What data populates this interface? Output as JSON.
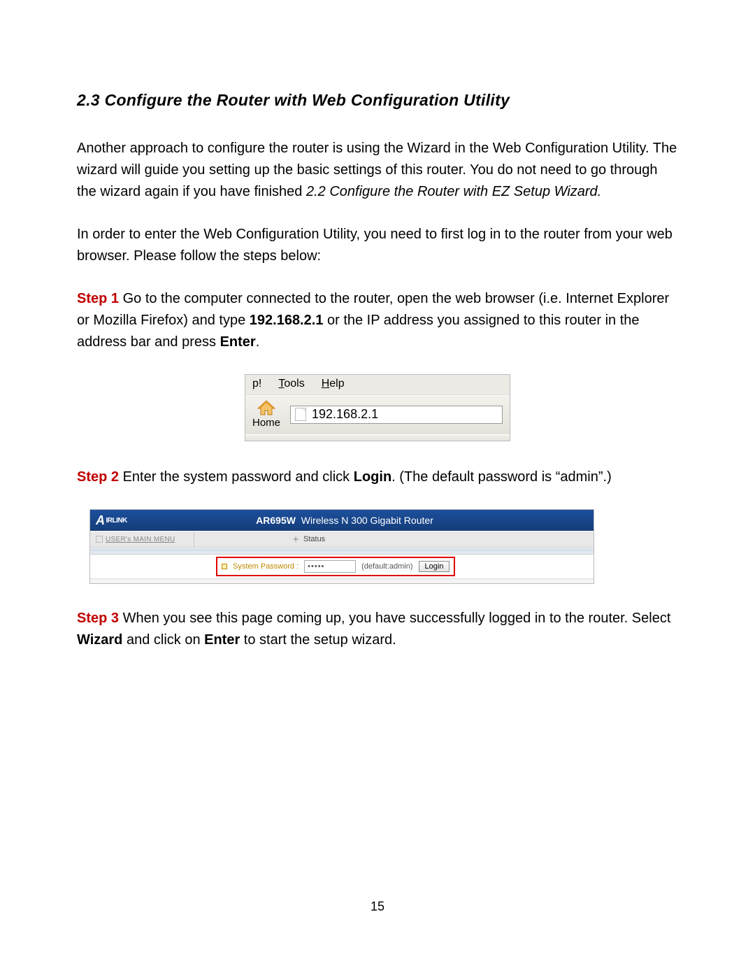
{
  "section": {
    "title": "2.3 Configure the Router with Web Configuration Utility"
  },
  "para1": {
    "t1": "Another approach to configure the router is using the Wizard in the Web Configuration Utility. The wizard will guide you setting up the basic settings of this router. You do not need to go through the wizard again if you have finished ",
    "ref": "2.2 Configure the Router with EZ Setup Wizard.",
    "t2": ""
  },
  "para2": "In order to enter the Web Configuration Utility, you need to first log in to the router from your web browser. Please follow the steps below:",
  "step1": {
    "label": "Step 1",
    "t1": " Go to the computer connected to the router, open the web browser (i.e. Internet Explorer or Mozilla Firefox) and type ",
    "ip": "192.168.2.1",
    "t2": " or the IP address you assigned to this router in the address bar and press ",
    "enter": "Enter",
    "t3": "."
  },
  "browser": {
    "menu_partial": "p!",
    "tools_pre": "T",
    "tools_rest": "ools",
    "help_pre": "H",
    "help_rest": "elp",
    "home": "Home",
    "address": "192.168.2.1"
  },
  "step2": {
    "label": "Step 2",
    "t1": " Enter the system password and click ",
    "login": "Login",
    "t2": ". (The default password is “admin”.)"
  },
  "router": {
    "brand_a": "A",
    "brand_rest": "IRLINK",
    "model": "AR695W",
    "desc": "Wireless N 300 Gigabit Router",
    "menu_label": "USER's MAIN MENU",
    "status": "Status",
    "syspass_label": "System Password :",
    "pw_value": "•••••",
    "default_hint": "(default:admin)",
    "login_btn": "Login"
  },
  "step3": {
    "label": "Step 3",
    "t1": " When you see this page coming up, you have successfully logged in to the router. Select ",
    "wizard": "Wizard",
    "t2": " and click on ",
    "enter": "Enter",
    "t3": " to start the setup wizard."
  },
  "page_number": "15"
}
